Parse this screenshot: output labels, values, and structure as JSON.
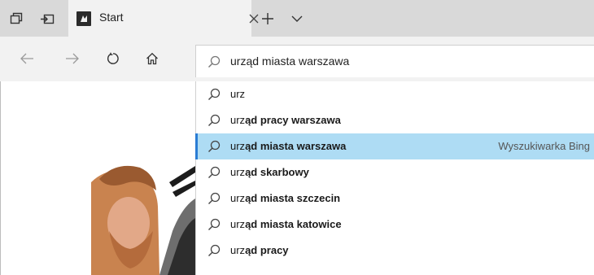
{
  "tabs": {
    "active_title": "Start"
  },
  "address_bar": {
    "value": "urząd miasta warszawa"
  },
  "suggestions": [
    {
      "prefix": "urz",
      "rest": "",
      "source": ""
    },
    {
      "prefix": "urz",
      "rest": "ąd pracy warszawa",
      "source": ""
    },
    {
      "prefix": "urz",
      "rest": "ąd miasta warszawa",
      "source": "Wyszukiwarka Bing",
      "selected": true
    },
    {
      "prefix": "urz",
      "rest": "ąd skarbowy",
      "source": ""
    },
    {
      "prefix": "urz",
      "rest": "ąd miasta szczecin",
      "source": ""
    },
    {
      "prefix": "urz",
      "rest": "ąd miasta katowice",
      "source": ""
    },
    {
      "prefix": "urz",
      "rest": "ąd pracy",
      "source": ""
    }
  ],
  "icons": {
    "tab_preview": "tab-preview-icon",
    "set_aside": "set-aside-tabs-icon",
    "favicon": "start-page-favicon",
    "close": "close-icon",
    "new_tab": "plus-icon",
    "tab_menu": "chevron-down-icon",
    "back": "back-arrow-icon",
    "forward": "forward-arrow-icon",
    "refresh": "refresh-icon",
    "home": "home-icon",
    "search": "search-icon"
  },
  "colors": {
    "selected_row": "#aedcf4",
    "selection_accent": "#2a7cd4",
    "tab_strip": "#d9d9d9",
    "toolbar": "#f2f2f2"
  }
}
